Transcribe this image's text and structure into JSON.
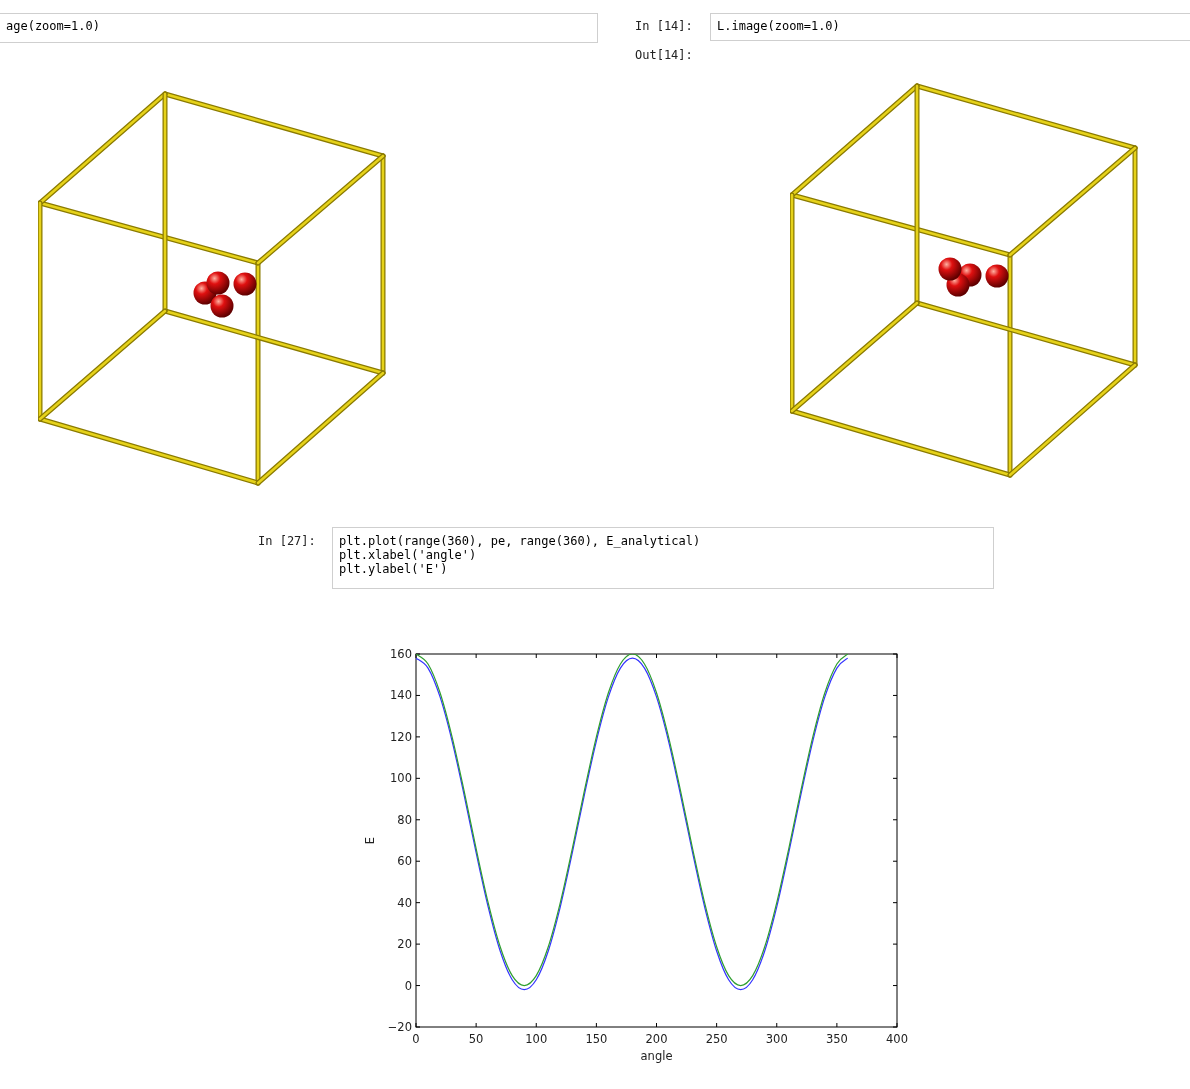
{
  "cells": [
    {
      "input": [
        "age(zoom=1.0)"
      ]
    },
    {
      "prompt": "In [14]:",
      "input": [
        "L.image(zoom=1.0)"
      ],
      "out_prompt": "Out[14]:"
    },
    {
      "prompt": "In [27]:",
      "input": [
        "plt.plot(range(360), pe, range(360), E_analytical)",
        "plt.xlabel('angle')",
        "plt.ylabel('E')"
      ],
      "chart_data": {
        "type": "line",
        "xlabel": "angle",
        "ylabel": "E",
        "xlim": [
          0,
          400
        ],
        "ylim": [
          -20,
          160
        ],
        "xticks": [
          0,
          50,
          100,
          150,
          200,
          250,
          300,
          350,
          400
        ],
        "yticks": [
          {
            "value": -20,
            "label": "−20"
          },
          0,
          20,
          40,
          60,
          80,
          100,
          120,
          140,
          160
        ],
        "x": [
          0,
          10,
          20,
          30,
          40,
          50,
          60,
          70,
          80,
          90,
          100,
          110,
          120,
          130,
          140,
          150,
          160,
          170,
          180,
          190,
          200,
          210,
          220,
          230,
          240,
          250,
          260,
          270,
          280,
          290,
          300,
          310,
          320,
          330,
          340,
          350,
          359
        ],
        "series": [
          {
            "color": "#3333ff",
            "values": [
              158,
              153.2,
              139.3,
              118,
              91.9,
              64.1,
              38,
              16.7,
              2.8,
              -2,
              2.8,
              16.7,
              38,
              64.1,
              91.9,
              118,
              139.3,
              153.2,
              158,
              153.2,
              139.3,
              118,
              91.9,
              64.1,
              38,
              16.7,
              2.8,
              -2,
              2.8,
              16.7,
              38,
              64.1,
              91.9,
              118,
              139.3,
              153.2,
              158
            ]
          },
          {
            "color": "#2e9e2e",
            "values": [
              160,
              155.2,
              141.3,
              120,
              93.9,
              66.1,
              40,
              18.7,
              4.8,
              0,
              4.8,
              18.7,
              40,
              66.1,
              93.9,
              120,
              141.3,
              155.2,
              160,
              155.2,
              141.3,
              120,
              93.9,
              66.1,
              40,
              18.7,
              4.8,
              0,
              4.8,
              18.7,
              40,
              66.1,
              93.9,
              120,
              141.3,
              155.2,
              160
            ]
          }
        ]
      }
    }
  ]
}
